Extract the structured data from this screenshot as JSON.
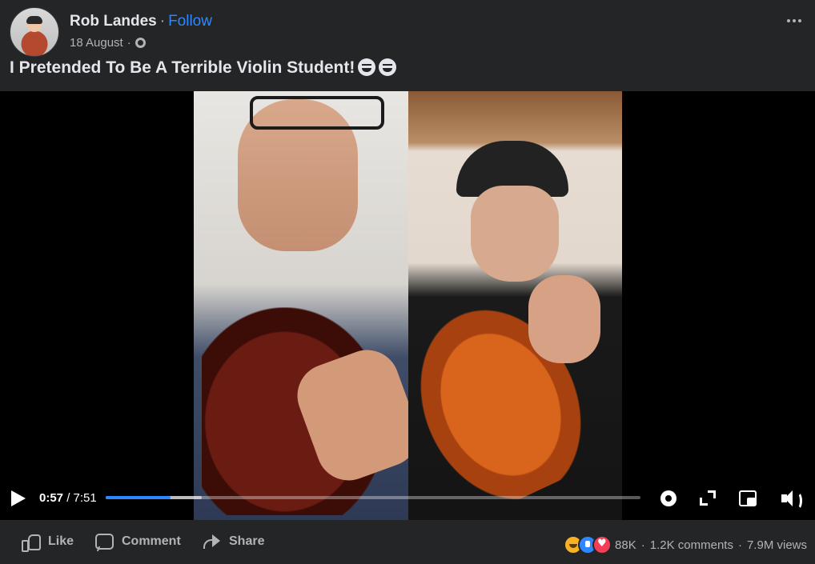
{
  "post": {
    "author": "Rob Landes",
    "separator": "·",
    "follow_label": "Follow",
    "date": "18 August",
    "date_separator": "·",
    "title": "I Pretended To Be A Terrible Violin Student!"
  },
  "icons": {
    "avatar": "author-avatar",
    "privacy": "globe-icon",
    "more": "more-options-icon",
    "title_emojis": [
      "grinning-face-icon",
      "grinning-face-icon"
    ]
  },
  "video": {
    "current_time": "0:57",
    "time_separator": "/",
    "duration": "7:51",
    "played_fraction": 0.121,
    "buffered_fraction": 0.18,
    "controls": [
      "settings-icon",
      "fullscreen-icon",
      "picture-in-picture-icon",
      "volume-icon"
    ]
  },
  "actions": {
    "like": "Like",
    "comment": "Comment",
    "share": "Share"
  },
  "stats": {
    "reaction_count": "88K",
    "comments": "1.2K comments",
    "separator": "·",
    "views": "7.9M views"
  },
  "colors": {
    "background": "#242526",
    "accent": "#2d88ff",
    "text_primary": "#e4e6eb",
    "text_secondary": "#b0b3b8"
  }
}
